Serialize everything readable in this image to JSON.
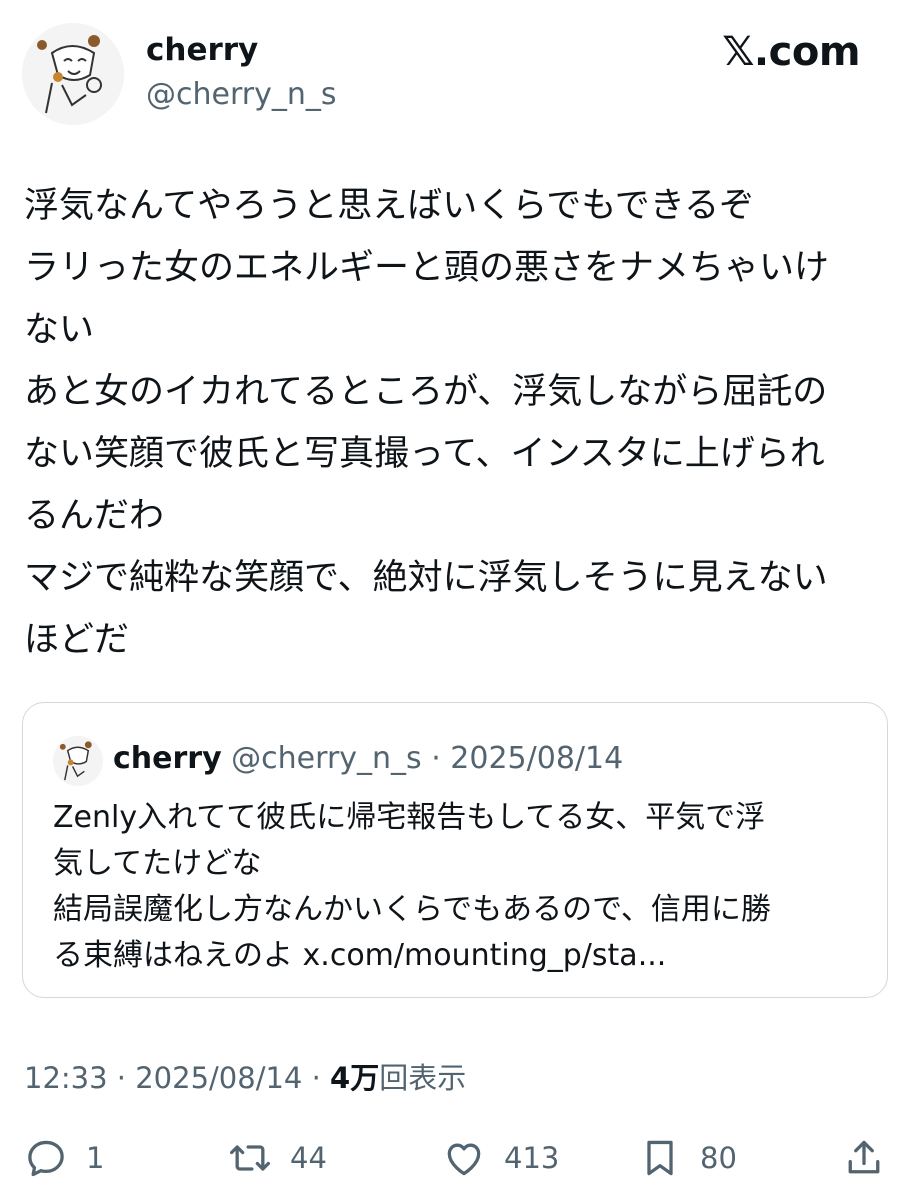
{
  "author": {
    "name": "cherry",
    "handle": "@cherry_n_s"
  },
  "brand": "𝕏.com",
  "tweet": {
    "lines": [
      "浮気なんてやろうと思えばいくらでもできるぞ",
      "ラリった女のエネルギーと頭の悪さをナメちゃいけ",
      "ない",
      "あと女のイカれてるところが、浮気しながら屈託の",
      "ない笑顔で彼氏と写真撮って、インスタに上げられ",
      "るんだわ",
      "マジで純粋な笑顔で、絶対に浮気しそうに見えない",
      "ほどだ"
    ]
  },
  "quote": {
    "name": "cherry",
    "meta": " @cherry_n_s · 2025/08/14",
    "lines": [
      "Zenly入れてて彼氏に帰宅報告もしてる女、平気で浮",
      "気してたけどな",
      "結局誤魔化し方なんかいくらでもあるので、信用に勝",
      "る束縛はねえのよ x.com/mounting_p/sta..."
    ]
  },
  "meta": {
    "time_date": "12:33 · 2025/08/14 · ",
    "views_count": "4万",
    "views_label": "回表示"
  },
  "actions": {
    "reply_count": "1",
    "retweet_count": "44",
    "like_count": "413",
    "bookmark_count": "80"
  },
  "icons": [
    "reply-icon",
    "retweet-icon",
    "like-icon",
    "bookmark-icon",
    "share-icon"
  ],
  "colors": {
    "text": "#0f1419",
    "secondary": "#536471",
    "border": "#cfd9de"
  }
}
